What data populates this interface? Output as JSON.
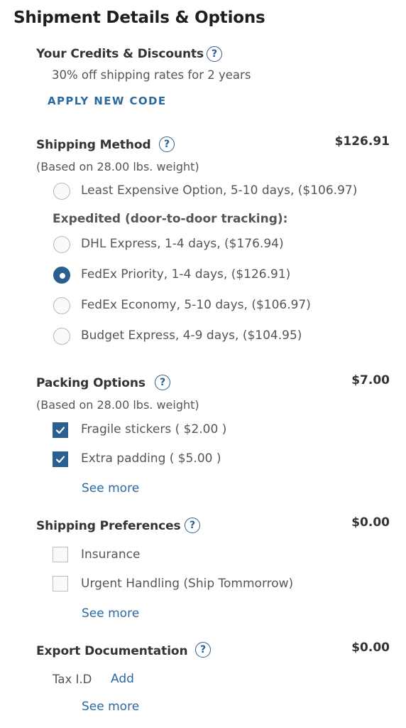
{
  "page_title": "Shipment Details & Options",
  "credits": {
    "title": "Your Credits & Discounts",
    "help": "?",
    "description": "30% off shipping rates for 2 years",
    "apply_code": "APPLY NEW CODE"
  },
  "shipping_method": {
    "title": "Shipping Method",
    "help": "?",
    "price": "$126.91",
    "weight_note": "(Based on 28.00 lbs. weight)",
    "options": [
      {
        "label": "Least Expensive Option, 5-10 days, ($106.97)",
        "checked": false
      },
      {
        "label": "DHL Express, 1-4 days, ($176.94)",
        "checked": false
      },
      {
        "label": "FedEx Priority, 1-4 days, ($126.91)",
        "checked": true
      },
      {
        "label": "FedEx Economy, 5-10 days, ($106.97)",
        "checked": false
      },
      {
        "label": "Budget Express, 4-9 days, ($104.95)",
        "checked": false
      }
    ],
    "expedited_heading": "Expedited (door-to-door tracking):"
  },
  "packing": {
    "title": "Packing Options",
    "help": "?",
    "price": "$7.00",
    "weight_note": "(Based on 28.00 lbs. weight)",
    "options": [
      {
        "label": "Fragile stickers ( $2.00 )",
        "checked": true
      },
      {
        "label": "Extra padding ( $5.00 )",
        "checked": true
      }
    ],
    "see_more": "See more"
  },
  "preferences": {
    "title": "Shipping Preferences",
    "help": "?",
    "price": "$0.00",
    "options": [
      {
        "label": "Insurance",
        "checked": false
      },
      {
        "label": "Urgent Handling (Ship Tommorrow)",
        "checked": false
      }
    ],
    "see_more": "See more"
  },
  "export_docs": {
    "title": "Export Documentation",
    "help": "?",
    "price": "$0.00",
    "tax_label": "Tax I.D",
    "add_link": "Add",
    "see_more": "See more"
  },
  "colors": {
    "accent": "#2b5f90",
    "link": "#2a6aa1"
  }
}
